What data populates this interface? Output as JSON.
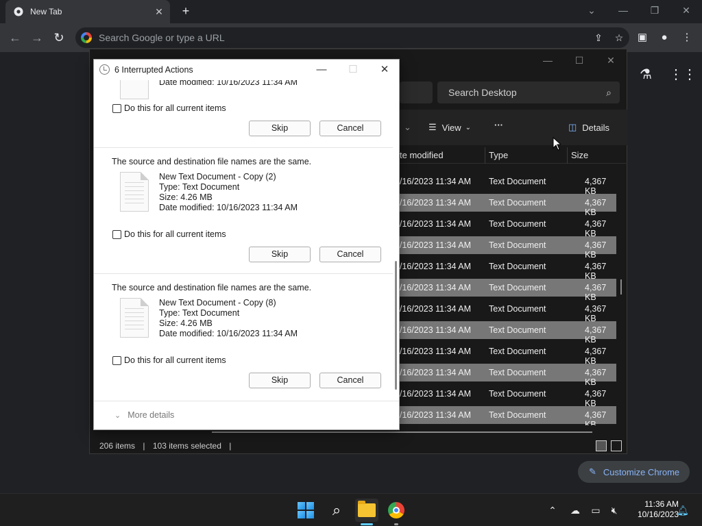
{
  "browser": {
    "tab_title": "New Tab",
    "omnibox_placeholder": "Search Google or type a URL",
    "customize_label": "Customize Chrome"
  },
  "explorer": {
    "search_placeholder": "Search Desktop",
    "cmd_view": "View",
    "cmd_more": "···",
    "cmd_details": "Details",
    "columns": {
      "date": "te modified",
      "type": "Type",
      "size": "Size"
    },
    "rows": [
      {
        "date": "/16/2023 11:34 AM",
        "type": "Text Document",
        "size": "4,367 KB"
      },
      {
        "date": "/16/2023 11:34 AM",
        "type": "Text Document",
        "size": "4,367 KB"
      },
      {
        "date": "/16/2023 11:34 AM",
        "type": "Text Document",
        "size": "4,367 KB"
      },
      {
        "date": "/16/2023 11:34 AM",
        "type": "Text Document",
        "size": "4,367 KB"
      },
      {
        "date": "/16/2023 11:34 AM",
        "type": "Text Document",
        "size": "4,367 KB"
      },
      {
        "date": "/16/2023 11:34 AM",
        "type": "Text Document",
        "size": "4,367 KB"
      },
      {
        "date": "/16/2023 11:34 AM",
        "type": "Text Document",
        "size": "4,367 KB"
      },
      {
        "date": "/16/2023 11:34 AM",
        "type": "Text Document",
        "size": "4,367 KB"
      },
      {
        "date": "/16/2023 11:34 AM",
        "type": "Text Document",
        "size": "4,367 KB"
      },
      {
        "date": "/16/2023 11:34 AM",
        "type": "Text Document",
        "size": "4,367 KB"
      },
      {
        "date": "/16/2023 11:34 AM",
        "type": "Text Document",
        "size": "4,367 KB"
      },
      {
        "date": "/16/2023 11:34 AM",
        "type": "Text Document",
        "size": "4,367 KB"
      }
    ],
    "status_items": "206 items",
    "status_selected": "103 items selected",
    "status_sep": "|"
  },
  "dialog": {
    "title": "6 Interrupted Actions",
    "partial": {
      "date_modified": "Date modified: 10/16/2023 11:34 AM",
      "checkbox_label": "Do this for all current items",
      "skip": "Skip",
      "cancel": "Cancel"
    },
    "conflicts": [
      {
        "message": "The source and destination file names are the same.",
        "name": "New Text Document - Copy (2)",
        "type": "Type: Text Document",
        "size": "Size: 4.26 MB",
        "date_modified": "Date modified: 10/16/2023 11:34 AM",
        "checkbox_label": "Do this for all current items",
        "skip": "Skip",
        "cancel": "Cancel"
      },
      {
        "message": "The source and destination file names are the same.",
        "name": "New Text Document - Copy (8)",
        "type": "Type: Text Document",
        "size": "Size: 4.26 MB",
        "date_modified": "Date modified: 10/16/2023 11:34 AM",
        "checkbox_label": "Do this for all current items",
        "skip": "Skip",
        "cancel": "Cancel"
      }
    ],
    "more_details": "More details"
  },
  "taskbar": {
    "time": "11:36 AM",
    "date": "10/16/2023"
  }
}
